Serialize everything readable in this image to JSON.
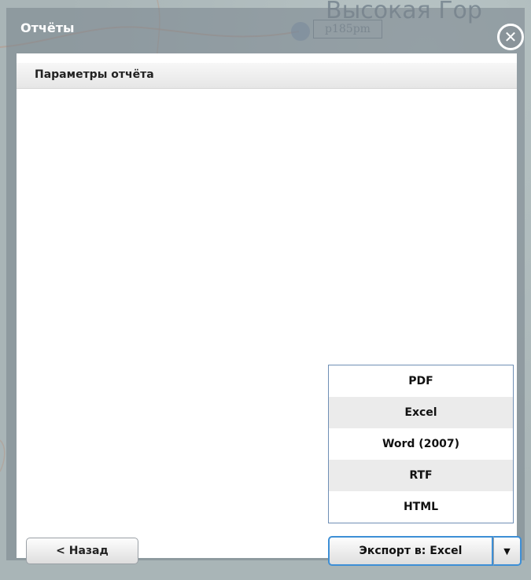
{
  "map": {
    "place_label": "Высокая Гор",
    "road_chip": "p185pm"
  },
  "dialog": {
    "title": "Отчёты",
    "close_icon": "close-icon"
  },
  "panel": {
    "title": "Параметры отчёта"
  },
  "export_menu": {
    "items": [
      "PDF",
      "Excel",
      "Word (2007)",
      "RTF",
      "HTML"
    ]
  },
  "footer": {
    "back_label": "< Назад",
    "export_label": "Экспорт в: Excel",
    "export_arrow": "▼"
  }
}
